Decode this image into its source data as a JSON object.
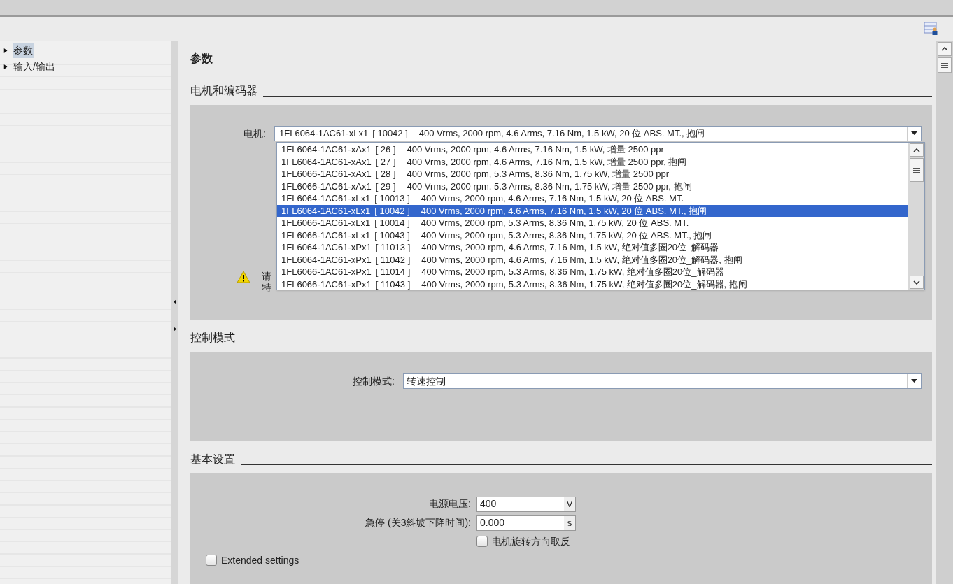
{
  "tree": [
    {
      "label": "参数",
      "selected": true,
      "expanded": false
    },
    {
      "label": "输入/输出",
      "selected": false,
      "expanded": false
    }
  ],
  "title": "参数",
  "sections": [
    {
      "kind": "motor",
      "heading": "电机和编码器",
      "label": "电机:",
      "value": {
        "model": "1FL6064-1AC61-xLx1",
        "id": "[ 10042 ]",
        "specs": "400 Vrms, 2000 rpm, 4.6 Arms, 7.16 Nm, 1.5 kW, 20 位 ABS. MT., 抱闸"
      },
      "warning": [
        "请",
        "特"
      ],
      "options": [
        {
          "model": "1FL6064-1AC61-xAx1",
          "id": "[ 26 ]",
          "specs": "400 Vrms, 2000 rpm, 4.6 Arms, 7.16 Nm, 1.5 kW, 增量 2500 ppr",
          "selected": false
        },
        {
          "model": "1FL6064-1AC61-xAx1",
          "id": "[ 27 ]",
          "specs": "400 Vrms, 2000 rpm, 4.6 Arms, 7.16 Nm, 1.5 kW, 增量 2500 ppr, 抱闸",
          "selected": false
        },
        {
          "model": "1FL6066-1AC61-xAx1",
          "id": "[ 28 ]",
          "specs": "400 Vrms, 2000 rpm, 5.3 Arms, 8.36 Nm, 1.75 kW, 增量 2500 ppr",
          "selected": false
        },
        {
          "model": "1FL6066-1AC61-xAx1",
          "id": "[ 29 ]",
          "specs": "400 Vrms, 2000 rpm, 5.3 Arms, 8.36 Nm, 1.75 kW, 增量 2500 ppr, 抱闸",
          "selected": false
        },
        {
          "model": "1FL6064-1AC61-xLx1",
          "id": "[ 10013 ]",
          "specs": "400 Vrms, 2000 rpm, 4.6 Arms, 7.16 Nm, 1.5 kW, 20 位 ABS. MT.",
          "selected": false
        },
        {
          "model": "1FL6064-1AC61-xLx1",
          "id": "[ 10042 ]",
          "specs": "400 Vrms, 2000 rpm, 4.6 Arms, 7.16 Nm, 1.5 kW, 20 位 ABS. MT., 抱闸",
          "selected": true
        },
        {
          "model": "1FL6066-1AC61-xLx1",
          "id": "[ 10014 ]",
          "specs": "400 Vrms, 2000 rpm, 5.3 Arms, 8.36 Nm, 1.75 kW, 20 位 ABS. MT.",
          "selected": false
        },
        {
          "model": "1FL6066-1AC61-xLx1",
          "id": "[ 10043 ]",
          "specs": "400 Vrms, 2000 rpm, 5.3 Arms, 8.36 Nm, 1.75 kW, 20 位 ABS. MT., 抱闸",
          "selected": false
        },
        {
          "model": "1FL6064-1AC61-xPx1",
          "id": "[ 11013 ]",
          "specs": "400 Vrms, 2000 rpm, 4.6 Arms, 7.16 Nm, 1.5 kW, 绝对值多圈20位_解码器",
          "selected": false
        },
        {
          "model": "1FL6064-1AC61-xPx1",
          "id": "[ 11042 ]",
          "specs": "400 Vrms, 2000 rpm, 4.6 Arms, 7.16 Nm, 1.5 kW, 绝对值多圈20位_解码器, 抱闸",
          "selected": false
        },
        {
          "model": "1FL6066-1AC61-xPx1",
          "id": "[ 11014 ]",
          "specs": "400 Vrms, 2000 rpm, 5.3 Arms, 8.36 Nm, 1.75 kW, 绝对值多圈20位_解码器",
          "selected": false
        },
        {
          "model": "1FL6066-1AC61-xPx1",
          "id": "[ 11043 ]",
          "specs": "400 Vrms, 2000 rpm, 5.3 Arms, 8.36 Nm, 1.75 kW, 绝对值多圈20位_解码器, 抱闸",
          "selected": false
        }
      ]
    },
    {
      "kind": "select",
      "heading": "控制模式",
      "label": "控制模式:",
      "value": "转速控制"
    },
    {
      "kind": "basic",
      "heading": "基本设置",
      "fields": [
        {
          "label": "电源电压:",
          "value": "400",
          "unit": "V"
        },
        {
          "label": "急停 (关3斜坡下降时间):",
          "value": "0.000",
          "unit": "s"
        }
      ],
      "checkboxes": [
        {
          "label": "电机旋转方向取反",
          "checked": false
        },
        {
          "label": "Extended settings",
          "checked": false
        }
      ]
    }
  ]
}
